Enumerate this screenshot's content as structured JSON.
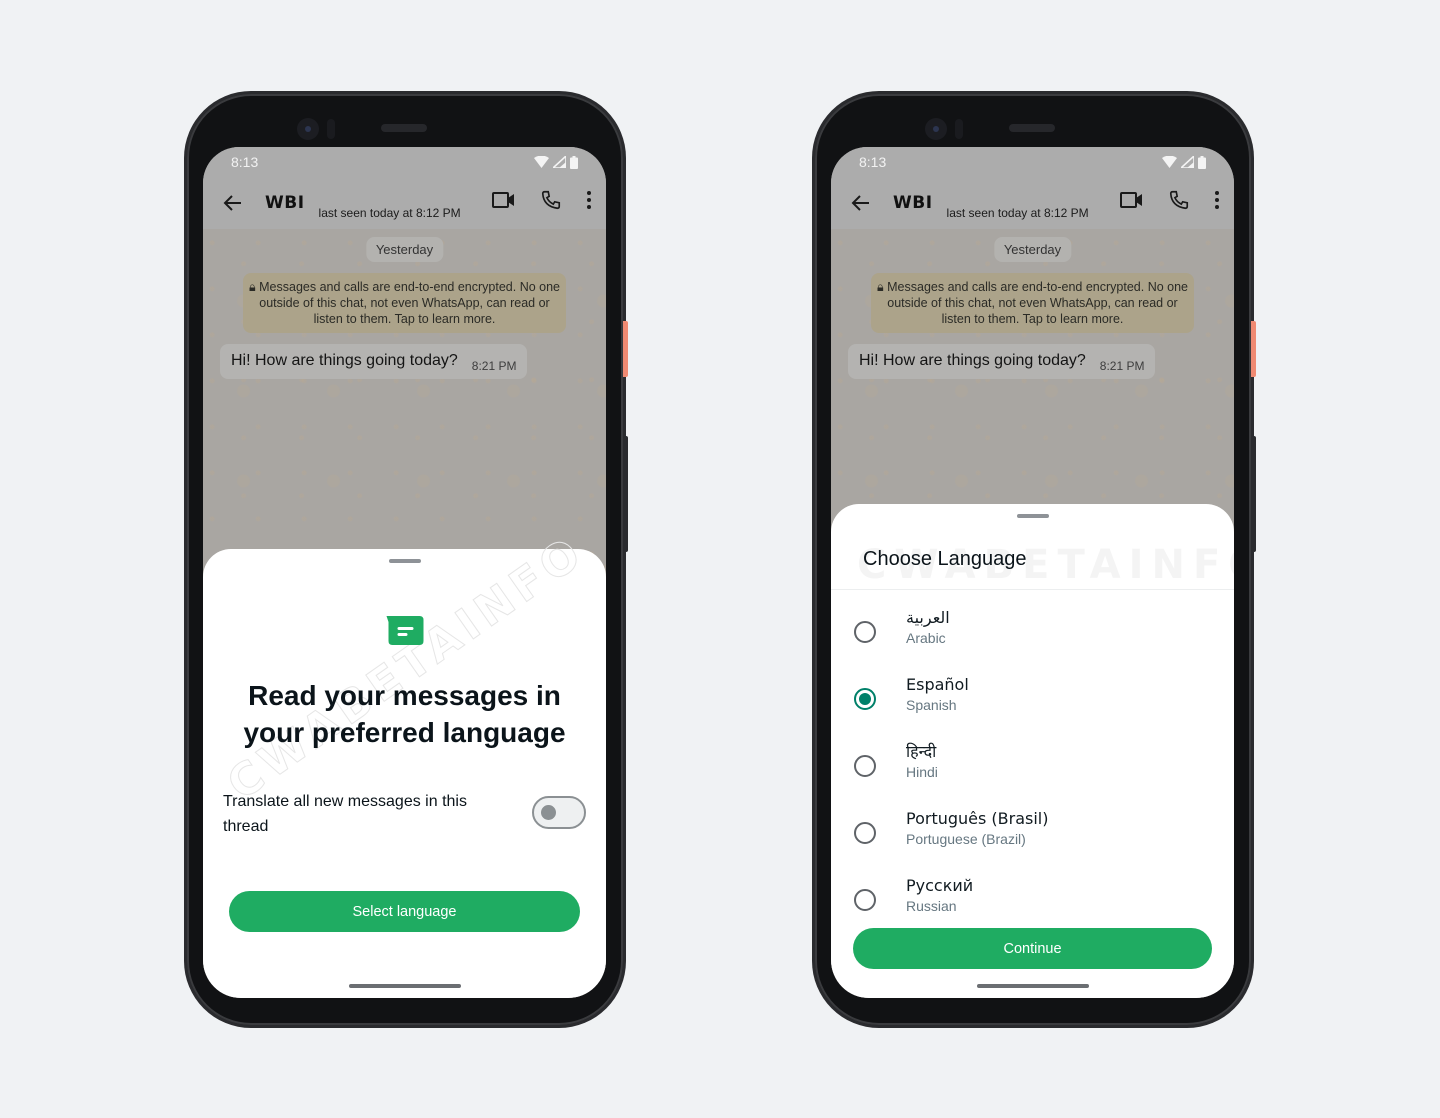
{
  "colors": {
    "accent_green": "#1fac62",
    "radio_teal": "#008069",
    "background": "#f0f2f4"
  },
  "phones": [
    {
      "status": {
        "time": "8:13",
        "icons": [
          "wifi-icon",
          "signal-icon",
          "battery-icon"
        ]
      },
      "appbar": {
        "back_icon": "arrow-left-icon",
        "contact_name": "WBI",
        "last_seen": "last seen today at 8:12 PM",
        "actions": [
          "video-call-icon",
          "voice-call-icon",
          "more-vert-icon"
        ]
      },
      "chat": {
        "date_label": "Yesterday",
        "encryption_note": "Messages and calls are end-to-end encrypted. No one outside of this chat, not even WhatsApp, can read or listen to them. Tap to learn more.",
        "message": {
          "text": "Hi! How are things going today?",
          "time": "8:21 PM"
        }
      },
      "sheet": {
        "icon": "message-bubble-icon",
        "title": "Read your messages in your preferred language",
        "toggle_label": "Translate all new messages in this thread",
        "toggle_on": false,
        "button_label": "Select language",
        "watermark": "CWABETAINFO"
      }
    },
    {
      "status": {
        "time": "8:13",
        "icons": [
          "wifi-icon",
          "signal-icon",
          "battery-icon"
        ]
      },
      "appbar": {
        "back_icon": "arrow-left-icon",
        "contact_name": "WBI",
        "last_seen": "last seen today at 8:12 PM",
        "actions": [
          "video-call-icon",
          "voice-call-icon",
          "more-vert-icon"
        ]
      },
      "chat": {
        "date_label": "Yesterday",
        "encryption_note": "Messages and calls are end-to-end encrypted. No one outside of this chat, not even WhatsApp, can read or listen to them. Tap to learn more.",
        "message": {
          "text": "Hi! How are things going today?",
          "time": "8:21 PM"
        }
      },
      "sheet": {
        "title": "Choose Language",
        "watermark": "CWABETAINFO",
        "languages": [
          {
            "native": "العربية",
            "english": "Arabic",
            "selected": false
          },
          {
            "native": "Español",
            "english": "Spanish",
            "selected": true
          },
          {
            "native": "हिन्दी",
            "english": "Hindi",
            "selected": false
          },
          {
            "native": "Português (Brasil)",
            "english": "Portuguese (Brazil)",
            "selected": false
          },
          {
            "native": "Русский",
            "english": "Russian",
            "selected": false
          }
        ],
        "button_label": "Continue"
      }
    }
  ]
}
